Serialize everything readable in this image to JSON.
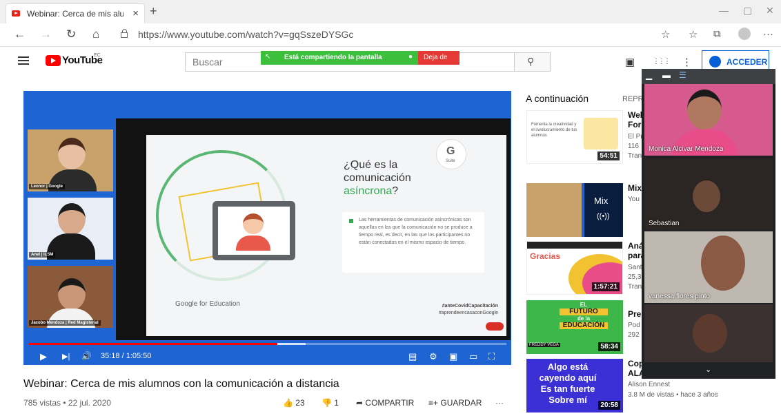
{
  "browser": {
    "tab_title": "Webinar: Cerca de mis alumnos c",
    "tab_close": "×",
    "new_tab": "+",
    "url": "https://www.youtube.com/watch?v=gqSszeDYSGc",
    "nav": {
      "back": "←",
      "forward": "→",
      "refresh": "↻",
      "home": "⌂"
    },
    "window": {
      "minimize": "—",
      "maximize": "▢",
      "close": "✕"
    },
    "toolbar_icons": {
      "favorite": "☆",
      "favorites_bar": "☆",
      "collections": "⧉",
      "more": "···"
    }
  },
  "youtube_header": {
    "logo_word": "YouTube",
    "country": "EC",
    "search_placeholder": "Buscar",
    "search_icon": "⚲",
    "acceder_label": "ACCEDER",
    "icons": {
      "create": "▣",
      "apps": "⋮⋮⋮",
      "settings": "⋮"
    }
  },
  "screen_share_bar": {
    "text": "Está compartiendo la pantalla",
    "stop_label": "Deja de",
    "icon1": "↖",
    "icon2": "●"
  },
  "player": {
    "time": "35:18 / 1:05:50",
    "progress_fraction": 0.52,
    "controls": {
      "play": "▶",
      "next": "▶|",
      "volume": "🔊",
      "subtitles": "▤",
      "settings": "⚙",
      "miniplayer": "▣",
      "theater": "▭",
      "fullscreen": "⛶"
    },
    "speakers": [
      {
        "label": "Leonor | Google"
      },
      {
        "label": "Anel | ILSM"
      },
      {
        "label": "Jacobo Mendoza | Red Magisterial"
      }
    ],
    "slide": {
      "gsuite_g": "G",
      "gsuite_s": "Suite",
      "title_line1": "¿Qué es la",
      "title_line2": "comunicación",
      "title_green": "asíncrona",
      "title_end": "?",
      "paragraph": "Las herramientas de comunicación asincrónicas son aquellas en las que la comunicación no se produce a tiempo real, es decir, en las que los participantes no están conectados en el mismo espacio de tiempo.",
      "footer": "Google for Education",
      "tag1": "#anteCovidCapacitación",
      "tag2": "#aprendeencasaconGoogle"
    }
  },
  "video": {
    "title": "Webinar: Cerca de mis alumnos con la comunicación a distancia",
    "meta": "785 vistas • 22 jul. 2020",
    "likes": "23",
    "dislikes": "1",
    "share_label": "COMPARTIR",
    "save_label": "GUARDAR",
    "more": "···"
  },
  "sidebar": {
    "up_next": "A continuación",
    "autoplay_label": "REPRO",
    "items": [
      {
        "title": "Web",
        "line2": "Forr",
        "line3": "El Pr",
        "line4": "116",
        "line5": "Tran",
        "duration": "54:51"
      },
      {
        "title": "Mix:",
        "line2": "You",
        "mix_label": "Mix",
        "duration": ""
      },
      {
        "title": "Aná",
        "line2": "para",
        "line3": "Sant",
        "line4": "25,3",
        "line5": "Tran",
        "duration": "1:57:21"
      },
      {
        "title": "Pres",
        "line2": "Pod",
        "line3": "292",
        "duration": "58:34",
        "thumb_text1": "EL",
        "thumb_text2": "FUTURO",
        "thumb_text3": "de la",
        "thumb_text4": "EDUCACIÓN",
        "thumb_text5": "FREDDY VEGA"
      },
      {
        "title": "Cop",
        "line2": "ALA",
        "line3": "Alison Ennest",
        "line4": "3.8 M de vistas • hace 3 años",
        "duration": "20:58",
        "thumb_text": "Algo está cayendo aquí Es tan fuerte Sobre mí"
      }
    ],
    "thumb1_caption": "Fomenta la creatividad y el involucramiento de tus alumnos",
    "thumb3_caption": "Gracias"
  },
  "meet": {
    "participants": [
      {
        "name": "Monica Alcivar Mendoza"
      },
      {
        "name": "Sebastian"
      },
      {
        "name": "vanessa flores pinto"
      },
      {
        "name": ""
      }
    ],
    "chevron": "⌄"
  },
  "colors": {
    "youtube_red": "#ff0000",
    "player_blue": "#1e64d2",
    "share_green": "#3cc03c",
    "stop_red": "#e53935",
    "link_blue": "#065fd4"
  }
}
